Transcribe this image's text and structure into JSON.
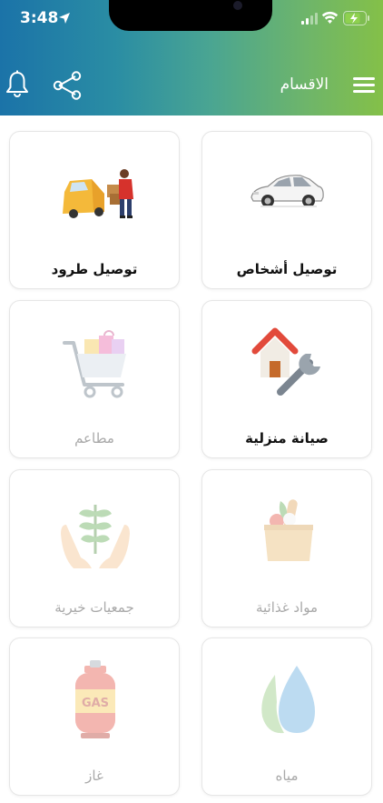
{
  "status_bar": {
    "time": "3:48"
  },
  "header": {
    "title": "الاقسام"
  },
  "categories": [
    {
      "label": "توصيل أشخاص",
      "icon": "car-icon",
      "enabled": true
    },
    {
      "label": "توصيل طرود",
      "icon": "delivery-van-icon",
      "enabled": true
    },
    {
      "label": "صيانة منزلية",
      "icon": "house-wrench-icon",
      "enabled": true
    },
    {
      "label": "مطاعم",
      "icon": "shopping-cart-icon",
      "enabled": false
    },
    {
      "label": "مواد غذائية",
      "icon": "grocery-bag-icon",
      "enabled": false
    },
    {
      "label": "جمعيات خيرية",
      "icon": "hands-plant-icon",
      "enabled": false
    },
    {
      "label": "مياه",
      "icon": "water-drop-icon",
      "enabled": false
    },
    {
      "label": "غاز",
      "icon": "gas-cylinder-icon",
      "enabled": false,
      "icon_text": "GAS"
    }
  ],
  "colors": {
    "header_start": "#1b73a8",
    "header_end": "#84c048",
    "disabled_text": "#a9a9a9"
  }
}
